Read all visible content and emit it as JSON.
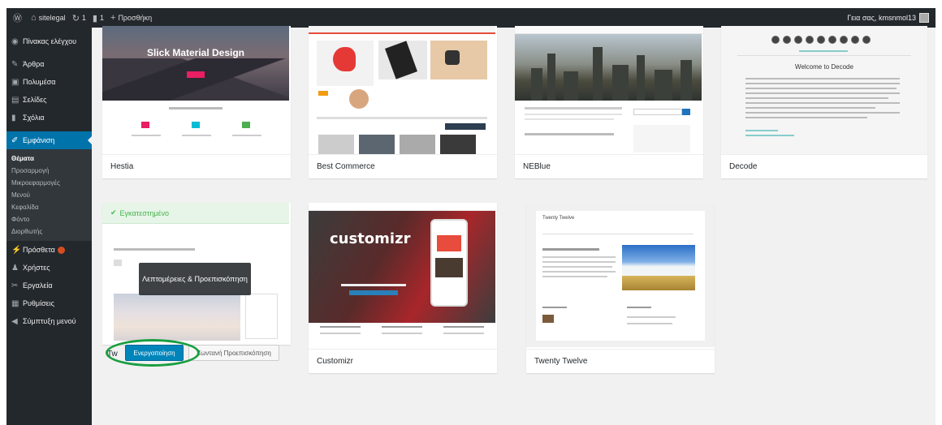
{
  "adminbar": {
    "site_name": "sitelegal",
    "updates_count": "1",
    "comments_count": "1",
    "new_label": "Προσθήκη",
    "howdy": "Γεια σας, kmsnmol13"
  },
  "sidebar": {
    "items_top": [
      {
        "label": "Πίνακας ελέγχου",
        "icon": "dashboard-icon"
      },
      {
        "label": "Άρθρα",
        "icon": "pin-icon"
      },
      {
        "label": "Πολυμέσα",
        "icon": "media-icon"
      },
      {
        "label": "Σελίδες",
        "icon": "page-icon"
      },
      {
        "label": "Σχόλια",
        "icon": "comment-icon"
      }
    ],
    "current": {
      "label": "Εμφάνιση",
      "icon": "brush-icon"
    },
    "submenu": [
      "Θέματα",
      "Προσαρμογή",
      "Μικροεφαρμογές",
      "Μενού",
      "Κεφαλίδα",
      "Φόντο",
      "Διορθωτής"
    ],
    "items_bottom": [
      {
        "label": "Πρόσθετα",
        "icon": "plugin-icon"
      },
      {
        "label": "Χρήστες",
        "icon": "user-icon"
      },
      {
        "label": "Εργαλεία",
        "icon": "tool-icon"
      },
      {
        "label": "Ρυθμίσεις",
        "icon": "settings-icon"
      },
      {
        "label": "Σύμπτυξη μενού",
        "icon": "collapse-icon"
      }
    ]
  },
  "themes": {
    "row1": [
      "Hestia",
      "Best Commerce",
      "NEBlue",
      "Decode"
    ],
    "hestia_hero": "Slick Material Design",
    "customizr_word": "customizr",
    "decode_heading": "Welcome to Decode",
    "active_notice": "Εγκατεστημένο",
    "overlay_label": "Λεπτομέρειες & Προεπισκόπηση",
    "active_name_prefix": "Tw",
    "activate_label": "Ενεργοποίηση",
    "live_preview_label": "Ζωντανή Προεπισκόπηση",
    "row2": [
      "Customizr",
      "Twenty Twelve"
    ],
    "twelve_header": "Twenty Twelve"
  }
}
